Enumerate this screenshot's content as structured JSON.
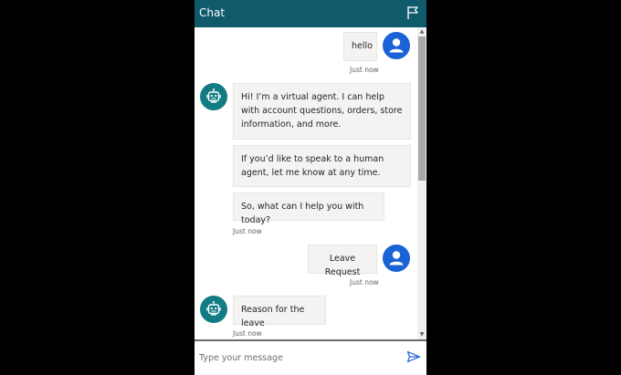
{
  "header": {
    "title": "Chat",
    "flag_icon": "flag-icon"
  },
  "messages": {
    "m1": {
      "text": "hello",
      "time": "Just now"
    },
    "m2": {
      "b1": "Hi! I’m a virtual agent. I can help with account questions, orders, store information, and more.",
      "b2": "If you’d like to speak to a human agent, let me know at any time.",
      "b3": "So, what can I help you with today?",
      "time": "Just now"
    },
    "m3": {
      "text": "Leave Request",
      "time": "Just now"
    },
    "m4": {
      "text": "Reason for the leave",
      "time": "Just now"
    }
  },
  "composer": {
    "placeholder": "Type your message",
    "value": "",
    "send_icon": "send-icon"
  },
  "colors": {
    "header_bg": "#0f5a6b",
    "user_avatar": "#1a63d6",
    "bot_avatar": "#117c84",
    "bubble_bg": "#f5f3f2",
    "send_icon": "#1a63d6"
  }
}
